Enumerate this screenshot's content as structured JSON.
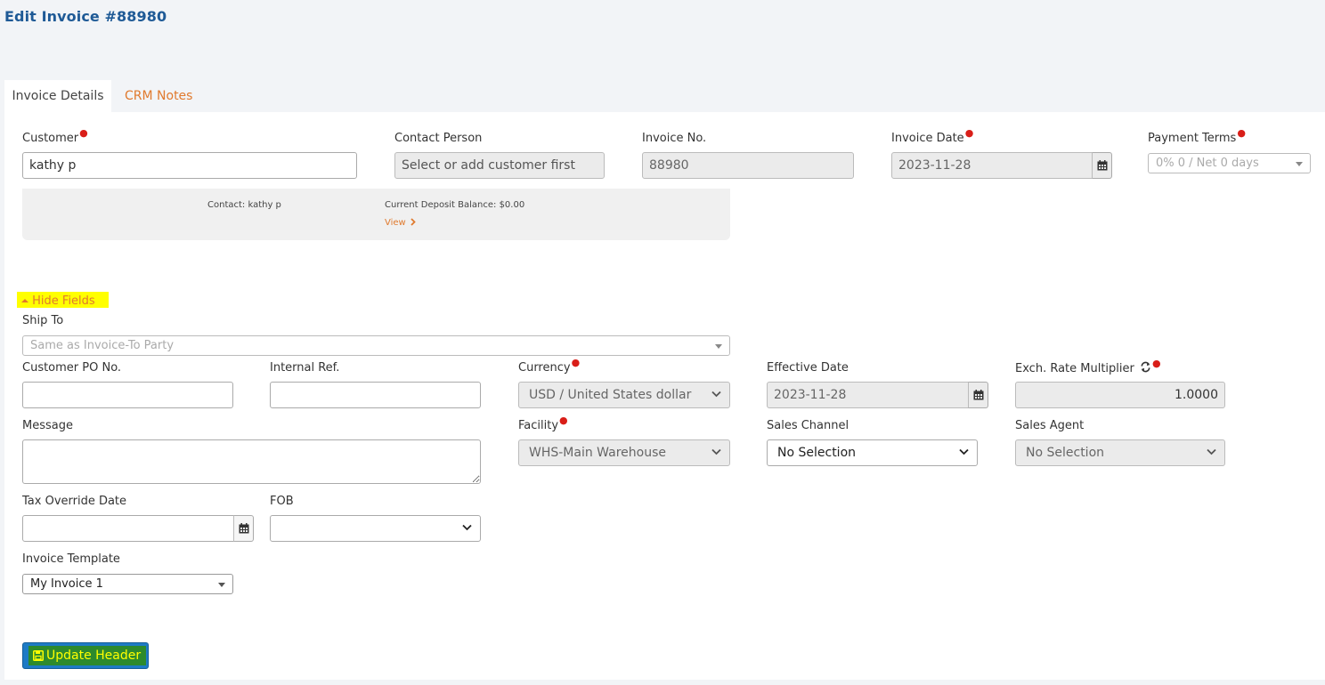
{
  "page": {
    "title": "Edit Invoice #88980"
  },
  "tabs": [
    {
      "label": "Invoice Details"
    },
    {
      "label": "CRM Notes"
    }
  ],
  "header_fields": {
    "customer": {
      "label": "Customer",
      "value": "kathy p"
    },
    "contact_person": {
      "label": "Contact Person",
      "placeholder": "Select or add customer first"
    },
    "invoice_no": {
      "label": "Invoice No.",
      "value": "88980"
    },
    "invoice_date": {
      "label": "Invoice Date",
      "value": "2023-11-28"
    },
    "payment_terms": {
      "label": "Payment Terms",
      "value": "0% 0 / Net 0 days"
    }
  },
  "customer_info": {
    "contact": "Contact: kathy p",
    "deposit_balance": "Current Deposit Balance: $0.00",
    "view_link": "View"
  },
  "toggle": {
    "label": "Hide Fields"
  },
  "details": {
    "ship_to": {
      "label": "Ship To",
      "value": "Same as Invoice-To Party"
    },
    "customer_po": {
      "label": "Customer PO No.",
      "value": ""
    },
    "internal_ref": {
      "label": "Internal Ref.",
      "value": ""
    },
    "currency": {
      "label": "Currency",
      "value": "USD / United States dollar"
    },
    "effective_date": {
      "label": "Effective Date",
      "value": "2023-11-28"
    },
    "exch_rate": {
      "label": "Exch. Rate Multiplier",
      "value": "1.0000"
    },
    "message": {
      "label": "Message",
      "value": ""
    },
    "facility": {
      "label": "Facility",
      "value": "WHS-Main Warehouse"
    },
    "sales_channel": {
      "label": "Sales Channel",
      "value": "No Selection"
    },
    "sales_agent": {
      "label": "Sales Agent",
      "value": "No Selection"
    },
    "tax_override_date": {
      "label": "Tax Override Date",
      "value": ""
    },
    "fob": {
      "label": "FOB",
      "value": ""
    },
    "invoice_template": {
      "label": "Invoice Template",
      "value": "My Invoice 1"
    }
  },
  "actions": {
    "update_header": "Update Header"
  },
  "colors": {
    "title": "#1f5a96",
    "accent_orange": "#e07a2e",
    "required": "#d91e18",
    "highlight": "#ffff00",
    "button_blue": "#1e7bc5",
    "button_green": "#2d8a2d"
  }
}
